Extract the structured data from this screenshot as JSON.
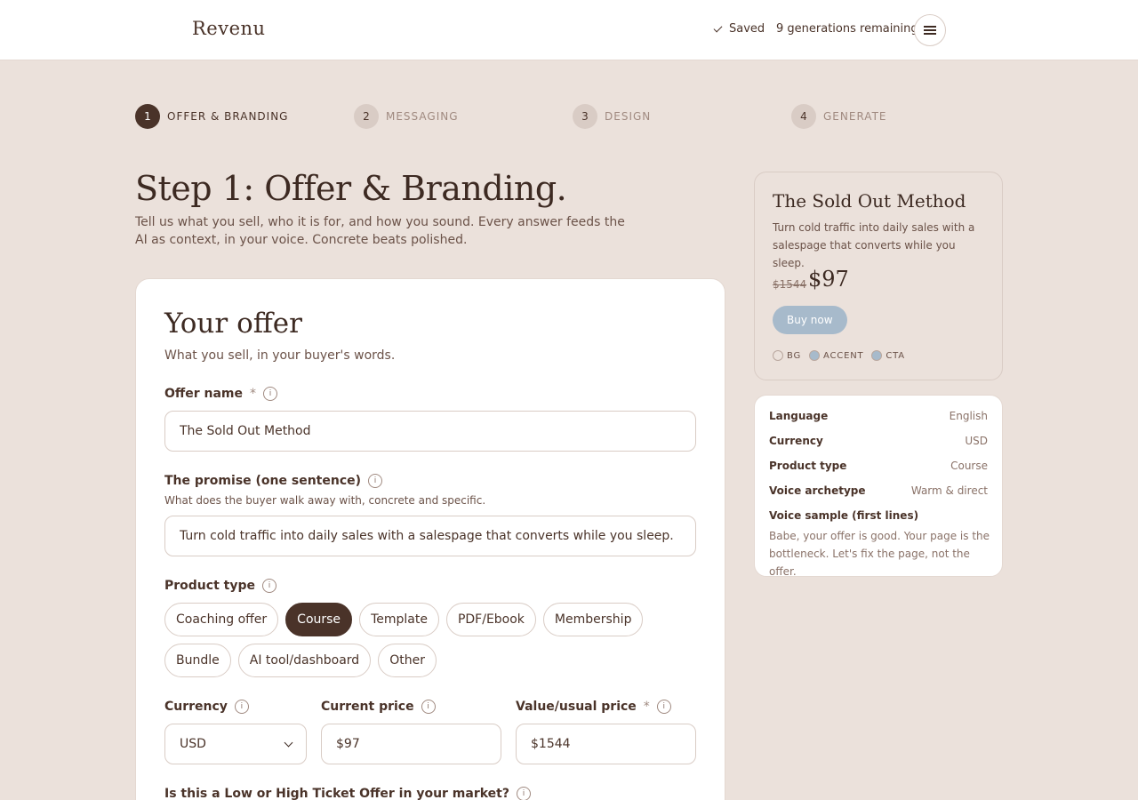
{
  "header": {
    "logo": "Revenu",
    "saved_label": "Saved",
    "generations": "9 generations remaining"
  },
  "steps": [
    {
      "num": "1",
      "label": "OFFER & BRANDING"
    },
    {
      "num": "2",
      "label": "MESSAGING"
    },
    {
      "num": "3",
      "label": "DESIGN"
    },
    {
      "num": "4",
      "label": "GENERATE"
    }
  ],
  "page": {
    "title": "Step 1: Offer & Branding.",
    "lead": "Tell us what you sell, who it is for, and how you sound. Every answer feeds the AI as context, in your voice. Concrete beats polished."
  },
  "offer": {
    "title": "Your offer",
    "subtitle": "What you sell, in your buyer's words.",
    "name_label": "Offer name",
    "required_mark": "*",
    "info_glyph": "i",
    "name_value": "The Sold Out Method",
    "promise_label": "The promise (one sentence)",
    "promise_help": "What does the buyer walk away with, concrete and specific.",
    "promise_value": "Turn cold traffic into daily sales with a salespage that converts while you sleep.",
    "type_label": "Product type",
    "types": [
      "Coaching offer",
      "Course",
      "Template",
      "PDF/Ebook",
      "Membership",
      "Bundle",
      "AI tool/dashboard",
      "Other"
    ],
    "selected_type": "Course",
    "currency_label": "Currency",
    "currency_value": "USD",
    "price_label": "Current price",
    "price_value": "$97",
    "value_label": "Value/usual price",
    "value_value": "$1544",
    "ticket_label": "Is this a Low or High Ticket Offer in your market?"
  },
  "preview": {
    "title": "The Sold Out Method",
    "promise": "Turn cold traffic into daily sales with a salespage that converts while you sleep.",
    "old_price": "$1544",
    "new_price": "$97",
    "buy_label": "Buy now",
    "swatches": [
      {
        "label": "BG",
        "color": "#ebe1db"
      },
      {
        "label": "ACCENT",
        "color": "#a7bacb"
      },
      {
        "label": "CTA",
        "color": "#a7bacb"
      }
    ]
  },
  "summary": {
    "rows": [
      {
        "key": "Language",
        "value": "English"
      },
      {
        "key": "Currency",
        "value": "USD"
      },
      {
        "key": "Product type",
        "value": "Course"
      },
      {
        "key": "Voice archetype",
        "value": "Warm & direct"
      }
    ],
    "voice_label": "Voice sample (first lines)",
    "voice_text": "Babe, your offer is good. Your page is the bottleneck. Let's fix the page, not the offer."
  },
  "colors": {
    "brand_dark": "#4a3329",
    "background": "#ebe1db",
    "accent": "#a7bacb"
  }
}
